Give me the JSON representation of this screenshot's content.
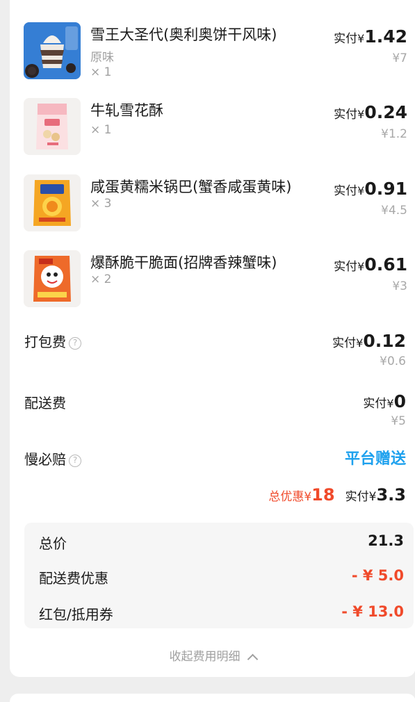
{
  "items": [
    {
      "name": "雪王大圣代(奥利奥饼干风味)",
      "spec": "原味",
      "qty": "× 1",
      "paid_label": "实付",
      "currency": "¥",
      "paid": "1.42",
      "original": "¥7"
    },
    {
      "name": "牛轧雪花酥",
      "spec": "",
      "qty": "× 1",
      "paid_label": "实付",
      "currency": "¥",
      "paid": "0.24",
      "original": "¥1.2"
    },
    {
      "name": "咸蛋黄糯米锅巴(蟹香咸蛋黄味)",
      "spec": "",
      "qty": "× 3",
      "paid_label": "实付",
      "currency": "¥",
      "paid": "0.91",
      "original": "¥4.5"
    },
    {
      "name": "爆酥脆干脆面(招牌香辣蟹味)",
      "spec": "",
      "qty": "× 2",
      "paid_label": "实付",
      "currency": "¥",
      "paid": "0.61",
      "original": "¥3"
    }
  ],
  "fees": {
    "packing": {
      "label": "打包费",
      "paid_label": "实付",
      "currency": "¥",
      "paid": "0.12",
      "original": "¥0.6"
    },
    "delivery": {
      "label": "配送费",
      "paid_label": "实付",
      "currency": "¥",
      "paid": "0",
      "original": "¥5"
    },
    "guarantee": {
      "label": "慢必赔",
      "value": "平台赠送"
    }
  },
  "summary": {
    "discount_label": "总优惠",
    "discount_currency": "¥",
    "discount": "18",
    "paid_label": "实付",
    "paid_currency": "¥",
    "paid": "3.3"
  },
  "detail": {
    "total": {
      "label": "总价",
      "value": "21.3"
    },
    "delivery_discount": {
      "label": "配送费优惠",
      "value": "- ¥ 5.0"
    },
    "coupon": {
      "label": "红包/抵用券",
      "value": "- ¥ 13.0"
    }
  },
  "collapse_label": "收起费用明细",
  "colors": {
    "accent_blue": "#1ea1ee",
    "discount_red": "#f04a2b"
  },
  "icons": {
    "help": "help-circle-icon",
    "collapse": "chevron-up-icon"
  }
}
